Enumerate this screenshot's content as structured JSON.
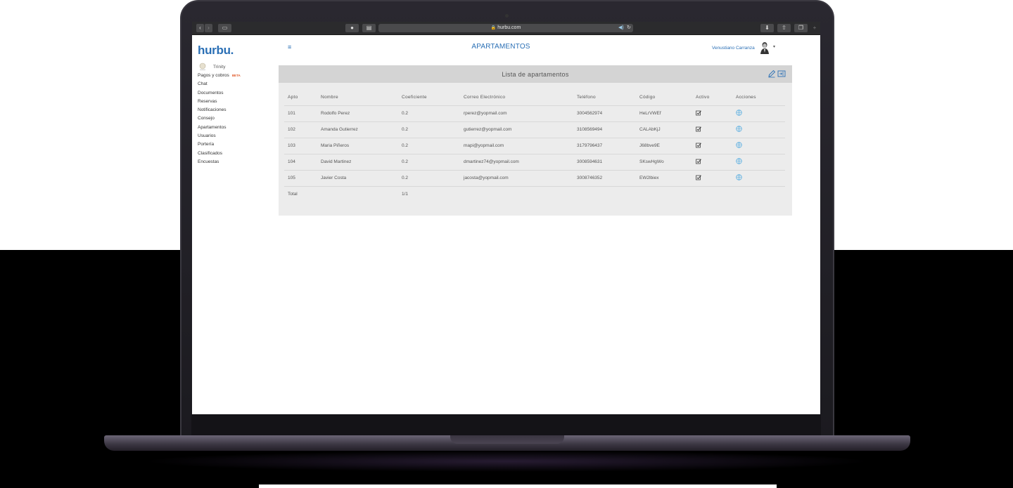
{
  "browser": {
    "url": "hurbu.com"
  },
  "app": {
    "logo_text": "hurbu",
    "logo_suffix": ".",
    "page_title": "APARTAMENTOS",
    "user_name": "Venustiano Carranza"
  },
  "sidebar": {
    "org_name": "Trinity",
    "items": [
      {
        "label": "Pagos y cobros",
        "badge": "BETA"
      },
      {
        "label": "Chat"
      },
      {
        "label": "Documentos"
      },
      {
        "label": "Reservas"
      },
      {
        "label": "Notificaciones"
      },
      {
        "label": "Consejo"
      },
      {
        "label": "Apartamentos"
      },
      {
        "label": "Usuarios"
      },
      {
        "label": "Portería"
      },
      {
        "label": "Clasificados"
      },
      {
        "label": "Encuestas"
      }
    ]
  },
  "panel": {
    "title": "Lista de apartamentos",
    "columns": [
      "Apto",
      "Nombre",
      "Coeficiente",
      "Correo Electrónico",
      "Teléfono",
      "Código",
      "Activo",
      "Acciones"
    ],
    "rows": [
      {
        "apto": "101",
        "nombre": "Rodolfo Perez",
        "coef": "0.2",
        "email": "rperez@yopmail.com",
        "tel": "3004562974",
        "codigo": "HeLrVWEf"
      },
      {
        "apto": "102",
        "nombre": "Amanda Gutierrez",
        "coef": "0.2",
        "email": "gutierrez@yopmail.com",
        "tel": "3108569494",
        "codigo": "CALAbKjJ"
      },
      {
        "apto": "103",
        "nombre": "Maria Piñeros",
        "coef": "0.2",
        "email": "mapi@yopmail.com",
        "tel": "3179796437",
        "codigo": "J68bve9E"
      },
      {
        "apto": "104",
        "nombre": "David Martinez",
        "coef": "0.2",
        "email": "dmartinez74@yopmail.com",
        "tel": "3008594631",
        "codigo": "SKswHgWo"
      },
      {
        "apto": "105",
        "nombre": "Javier Costa",
        "coef": "0.2",
        "email": "jacosta@yopmail.com",
        "tel": "3008746352",
        "codigo": "EW2lbiex"
      }
    ],
    "total_label": "Total",
    "total_coef": "1/1"
  },
  "colors": {
    "brand": "#2a6fb5",
    "beta": "#e05a2b",
    "action_icon": "#5aaee0"
  },
  "icons": [
    "hamburger-menu-icon",
    "edit-icon",
    "export-icon",
    "checkbox-checked-icon",
    "globe-action-icon",
    "lock-icon",
    "reload-icon",
    "speaker-icon"
  ]
}
